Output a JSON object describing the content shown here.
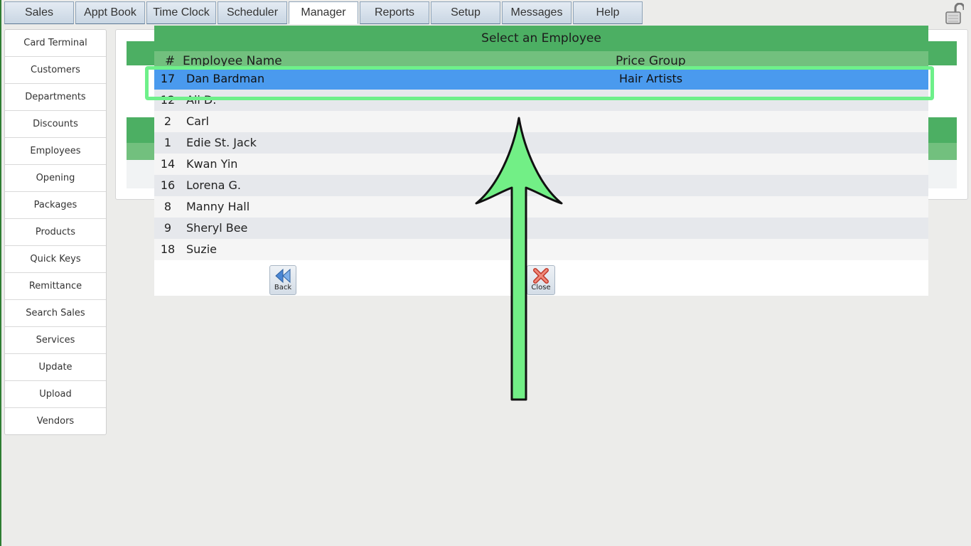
{
  "tabs": [
    {
      "label": "Sales"
    },
    {
      "label": "Appt Book"
    },
    {
      "label": "Time Clock"
    },
    {
      "label": "Scheduler"
    },
    {
      "label": "Manager",
      "active": true
    },
    {
      "label": "Reports"
    },
    {
      "label": "Setup"
    },
    {
      "label": "Messages"
    },
    {
      "label": "Help"
    }
  ],
  "sidebar": {
    "items": [
      {
        "label": "Card Terminal"
      },
      {
        "label": "Customers"
      },
      {
        "label": "Departments"
      },
      {
        "label": "Discounts"
      },
      {
        "label": "Employees"
      },
      {
        "label": "Opening"
      },
      {
        "label": "Packages"
      },
      {
        "label": "Products"
      },
      {
        "label": "Quick Keys"
      },
      {
        "label": "Remittance"
      },
      {
        "label": "Search Sales"
      },
      {
        "label": "Services"
      },
      {
        "label": "Update"
      },
      {
        "label": "Upload"
      },
      {
        "label": "Vendors"
      }
    ]
  },
  "modal": {
    "title": "Select an Employee",
    "col_num": "#",
    "col_name": "Employee Name",
    "col_price_group": "Price Group",
    "rows": [
      {
        "num": "17",
        "name": "Dan Bardman",
        "price_group": "Hair Artists",
        "selected": true
      },
      {
        "num": "12",
        "name": "Ali D.",
        "price_group": ""
      },
      {
        "num": "2",
        "name": "Carl",
        "price_group": ""
      },
      {
        "num": "1",
        "name": "Edie St. Jack",
        "price_group": ""
      },
      {
        "num": "14",
        "name": "Kwan Yin",
        "price_group": ""
      },
      {
        "num": "16",
        "name": "Lorena G.",
        "price_group": ""
      },
      {
        "num": "8",
        "name": "Manny Hall",
        "price_group": ""
      },
      {
        "num": "9",
        "name": "Sheryl Bee",
        "price_group": ""
      },
      {
        "num": "18",
        "name": "Suzie",
        "price_group": ""
      }
    ],
    "back_label": "Back",
    "close_label": "Close"
  },
  "colors": {
    "header_green": "#4caf63",
    "subheader_green": "#72c07e",
    "selected_row": "#4a9aee",
    "highlight": "#6ef08a"
  },
  "icons": {
    "lock": "lock-icon",
    "back": "double-chevron-left-icon",
    "close": "x-icon",
    "annotation": "arrow-up-icon"
  }
}
